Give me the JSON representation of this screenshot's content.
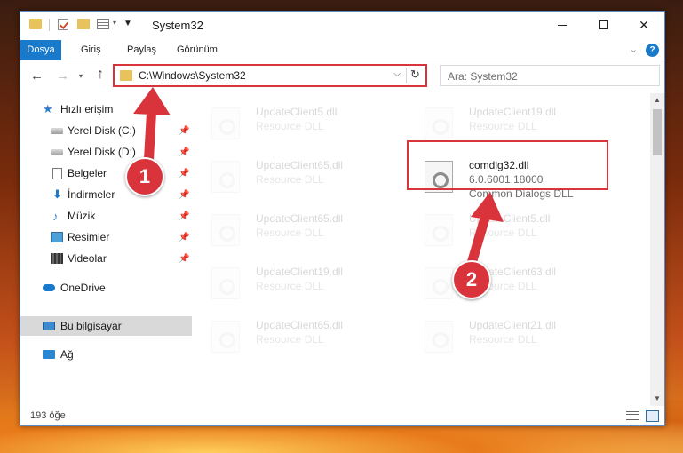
{
  "window": {
    "title": "System32",
    "controls": {
      "minimize": "",
      "maximize": "",
      "close": "✕"
    }
  },
  "ribbon": {
    "tabs": [
      "Dosya",
      "Giriş",
      "Paylaş",
      "Görünüm"
    ]
  },
  "address": {
    "path": "C:\\Windows\\System32",
    "search_placeholder": "Ara: System32"
  },
  "nav": {
    "items": [
      {
        "label": "Hızlı erişim",
        "icon": "star-icon"
      },
      {
        "label": "Yerel Disk (C:)",
        "icon": "drive-icon",
        "pinned": true
      },
      {
        "label": "Yerel Disk (D:)",
        "icon": "drive-icon",
        "pinned": true
      },
      {
        "label": "Belgeler",
        "icon": "documents-icon",
        "pinned": true
      },
      {
        "label": "İndirmeler",
        "icon": "downloads-icon",
        "pinned": true
      },
      {
        "label": "Müzik",
        "icon": "music-icon",
        "pinned": true
      },
      {
        "label": "Resimler",
        "icon": "pictures-icon",
        "pinned": true
      },
      {
        "label": "Videolar",
        "icon": "videos-icon",
        "pinned": true
      },
      {
        "label": "OneDrive",
        "icon": "cloud-icon"
      },
      {
        "label": "Bu bilgisayar",
        "icon": "computer-icon",
        "selected": true
      },
      {
        "label": "Ağ",
        "icon": "network-icon"
      }
    ]
  },
  "files": [
    {
      "name": "UpdateClient5.dll",
      "line2": "Resource DLL"
    },
    {
      "name": "UpdateClient19.dll",
      "line2": "Resource DLL"
    },
    {
      "name": "UpdateClient65.dll",
      "line2": "Resource DLL"
    },
    {
      "name": "comdlg32.dll",
      "line2": "6.0.6001.18000",
      "line3": "Common Dialogs DLL",
      "highlighted": true
    },
    {
      "name": "UpdateClient65.dll",
      "line2": "Resource DLL"
    },
    {
      "name": "UpdateClient5.dll",
      "line2": "Resource DLL"
    },
    {
      "name": "UpdateClient19.dll",
      "line2": "Resource DLL"
    },
    {
      "name": "UpdateClient63.dll",
      "line2": "Resource DLL"
    },
    {
      "name": "UpdateClient65.dll",
      "line2": "Resource DLL"
    },
    {
      "name": "UpdateClient21.dll",
      "line2": "Resource DLL"
    }
  ],
  "status": {
    "count": "193 öğe"
  },
  "annotations": [
    {
      "number": "1",
      "target": "address bar"
    },
    {
      "number": "2",
      "target": "comdlg32.dll"
    }
  ],
  "colors": {
    "accent": "#1979ca",
    "annotation_red": "#d9343b"
  }
}
